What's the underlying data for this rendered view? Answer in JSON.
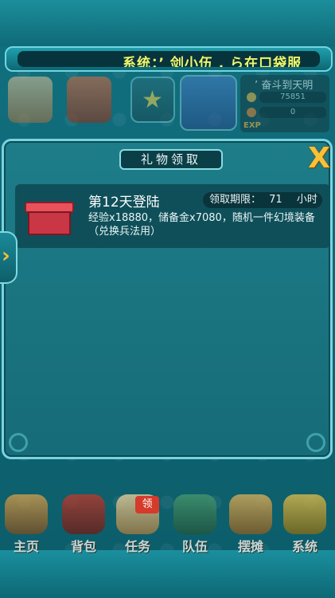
{
  "system_bar": {
    "text": "系统：’ 剑小伍 . ら在口袋服"
  },
  "hud": {
    "player_name": "’ 奋斗到天明",
    "gold": "75851",
    "ingots": "0",
    "exp_label": "EXP"
  },
  "dialog": {
    "title": "礼物领取",
    "close_label": "X"
  },
  "gift": {
    "name": "第12天登陆",
    "deadline_label": "领取期限：",
    "deadline_value": "71",
    "deadline_unit": "小时",
    "description": "经验x18880，储备金x7080，随机一件幻境装备（兑换兵法用）"
  },
  "side_tab": {
    "arrow": "›"
  },
  "menu": {
    "items": [
      {
        "label": "主页"
      },
      {
        "label": "背包"
      },
      {
        "label": "任务"
      },
      {
        "label": "队伍"
      },
      {
        "label": "摆摊"
      },
      {
        "label": "系统"
      }
    ],
    "task_badge": "领"
  },
  "colors": {
    "accent": "#79d3de",
    "marquee_text": "#f1f76a",
    "close_icon": "#f7c13a",
    "gift_red": "#c93645"
  }
}
